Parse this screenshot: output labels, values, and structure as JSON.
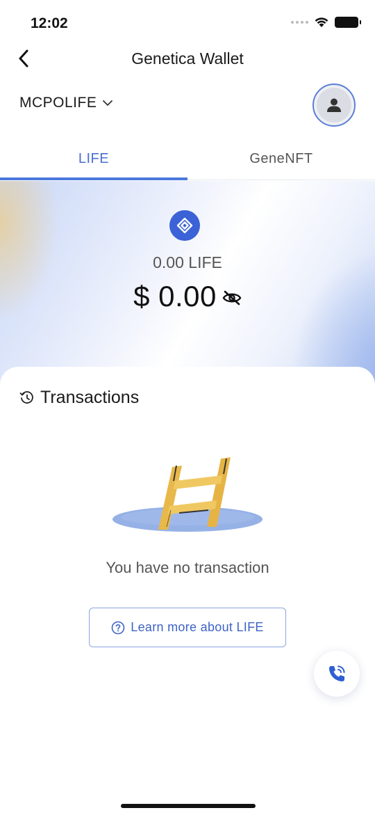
{
  "status_bar": {
    "time": "12:02"
  },
  "nav": {
    "title": "Genetica Wallet",
    "back_icon": "chevron-left-icon"
  },
  "account": {
    "name": "MCPOLIFE",
    "dropdown_icon": "chevron-down-icon",
    "avatar_icon": "person-icon"
  },
  "tabs": [
    {
      "label": "LIFE",
      "active": true
    },
    {
      "label": "GeneNFT",
      "active": false
    }
  ],
  "balance": {
    "token_amount": "0.00 LIFE",
    "fiat_amount": "$ 0.00",
    "coin_icon": "life-coin-icon",
    "visibility_icon": "eye-off-icon"
  },
  "transactions": {
    "title": "Transactions",
    "history_icon": "history-icon",
    "empty_message": "You have no transaction",
    "learn_more_label": "Learn more about LIFE",
    "help_icon": "question-circle-icon"
  },
  "support": {
    "icon": "phone-call-icon"
  },
  "colors": {
    "accent": "#4a78dc",
    "coin": "#3b62d6",
    "button_text": "#3e62c8",
    "ladder": "#e8b84a",
    "hole": "#7a9ee0"
  }
}
